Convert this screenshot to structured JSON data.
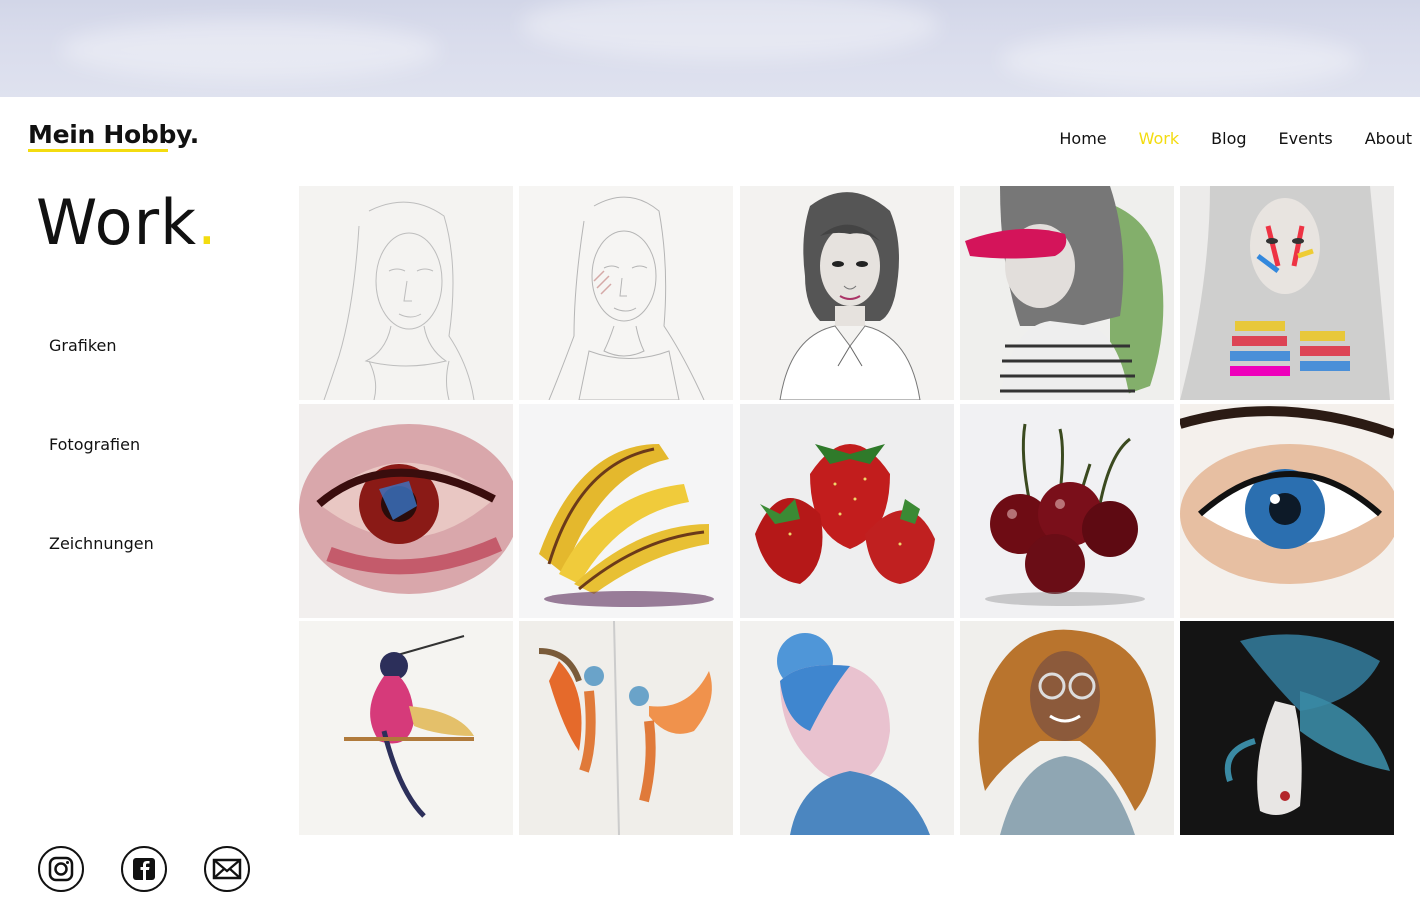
{
  "brand": {
    "name": "Mein Hobby.",
    "accent": "#f3dc10"
  },
  "nav": {
    "items": [
      {
        "label": "Home",
        "active": false
      },
      {
        "label": "Work",
        "active": true
      },
      {
        "label": "Blog",
        "active": false
      },
      {
        "label": "Events",
        "active": false
      },
      {
        "label": "About",
        "active": false
      }
    ]
  },
  "page": {
    "title": "Work",
    "title_dot": "."
  },
  "categories": [
    {
      "label": "Grafiken"
    },
    {
      "label": "Fotografien"
    },
    {
      "label": "Zeichnungen"
    }
  ],
  "gallery": [
    {
      "subject": "pencil-sketch-portrait-1",
      "bg": "#f4f3f1"
    },
    {
      "subject": "pencil-sketch-portrait-2",
      "bg": "#f6f5f3"
    },
    {
      "subject": "graphite-portrait-woman",
      "bg": "#f3f2f0"
    },
    {
      "subject": "portrait-pink-brushstroke",
      "bg": "#efefed"
    },
    {
      "subject": "portrait-colored-stripes",
      "bg": "#ecebea"
    },
    {
      "subject": "painted-red-eye",
      "bg": "#f2efee"
    },
    {
      "subject": "bananas",
      "bg": "#f5f5f6"
    },
    {
      "subject": "strawberries",
      "bg": "#eeeeef"
    },
    {
      "subject": "cherries",
      "bg": "#f1f1f3"
    },
    {
      "subject": "blue-eye",
      "bg": "#f4f0ec"
    },
    {
      "subject": "hummingbird",
      "bg": "#f5f4f1"
    },
    {
      "subject": "two-birds-sketchbook",
      "bg": "#f0eeea"
    },
    {
      "subject": "blue-hair-woman-profile",
      "bg": "#f2f1ef"
    },
    {
      "subject": "curly-hair-woman-glasses",
      "bg": "#f0efec"
    },
    {
      "subject": "betta-fish",
      "bg": "#141414"
    }
  ],
  "social": [
    {
      "icon": "instagram-icon"
    },
    {
      "icon": "facebook-icon"
    },
    {
      "icon": "mail-icon"
    }
  ]
}
